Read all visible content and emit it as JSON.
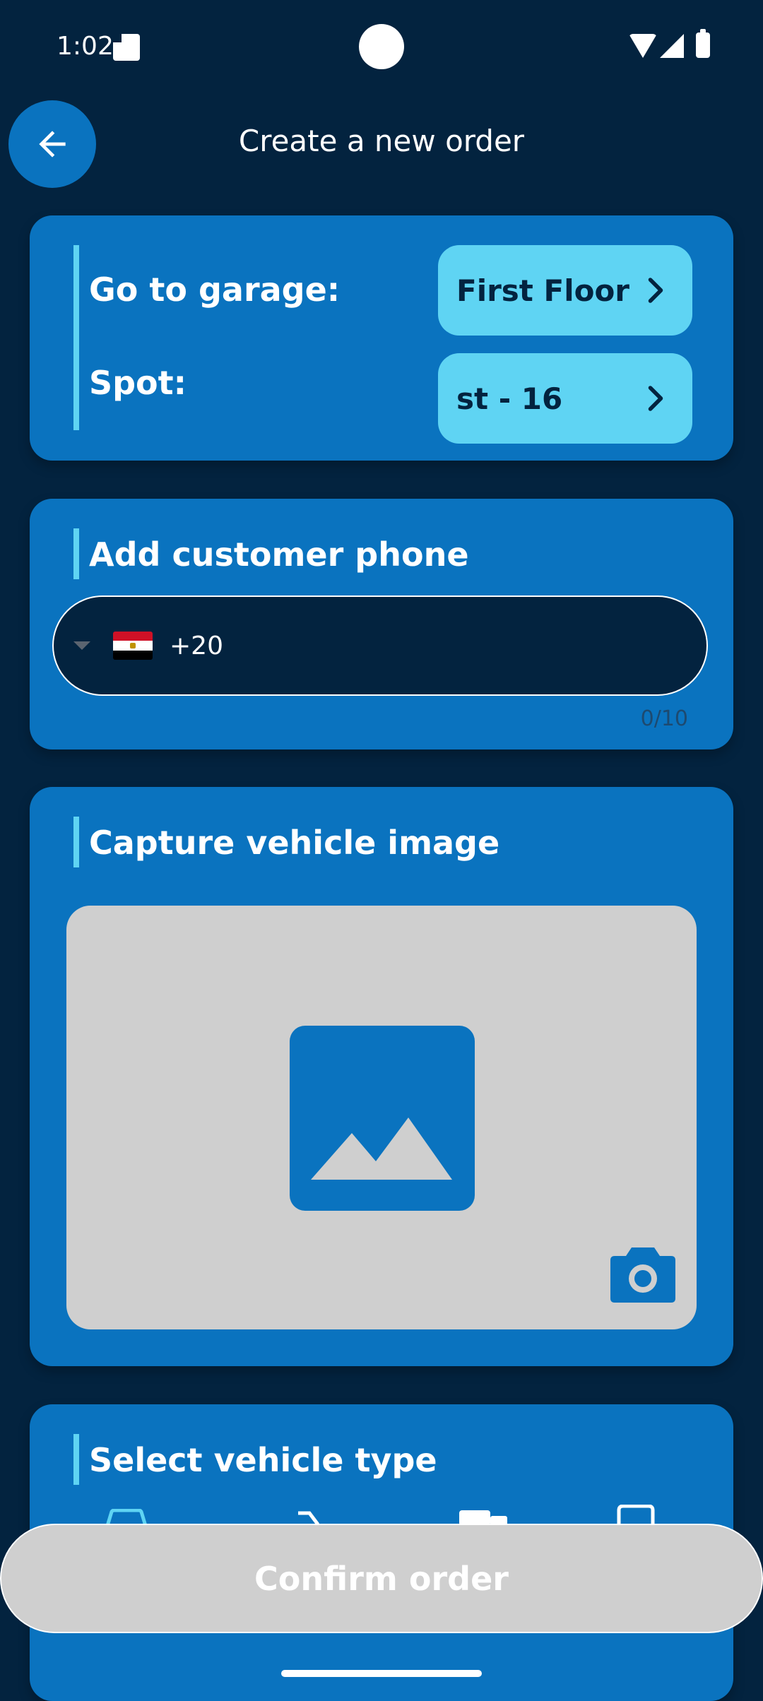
{
  "status_bar": {
    "time": "1:02"
  },
  "header": {
    "title": "Create a new order"
  },
  "location_card": {
    "garage_label": "Go to garage:",
    "spot_label": "Spot:",
    "garage_value": "First Floor",
    "spot_value": "st - 16"
  },
  "phone_card": {
    "title": "Add customer phone",
    "country_code": "+20",
    "value": "",
    "counter": "0/10"
  },
  "image_card": {
    "title": "Capture vehicle image"
  },
  "vehicle_card": {
    "title": "Select vehicle type"
  },
  "footer": {
    "confirm_label": "Confirm order"
  },
  "colors": {
    "background": "#03233f",
    "card": "#0a73bf",
    "accent": "#5fd4f3",
    "disabled_button": "#cfcfcf"
  }
}
